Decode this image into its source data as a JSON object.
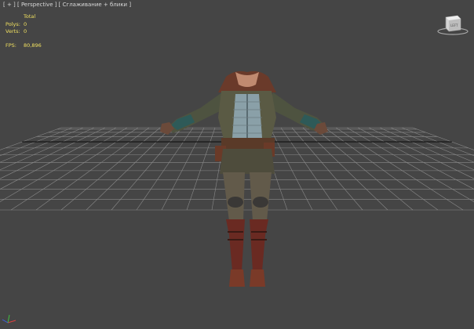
{
  "viewport": {
    "label": "[ + ] [ Perspective ] [ Сглаживание + блики ]",
    "background": "#454545"
  },
  "stats": {
    "header": "Total",
    "polys_label": "Polys:",
    "polys_value": "0",
    "verts_label": "Verts:",
    "verts_value": "0",
    "fps_label": "FPS:",
    "fps_value": "80,896",
    "color": "#f0e060"
  },
  "icons": {
    "viewcube": "viewcube-icon",
    "axis_gizmo": "axis-gizmo-icon"
  },
  "grid": {
    "color": "#8a8a8a",
    "center_line_color": "#1a1a1a"
  }
}
